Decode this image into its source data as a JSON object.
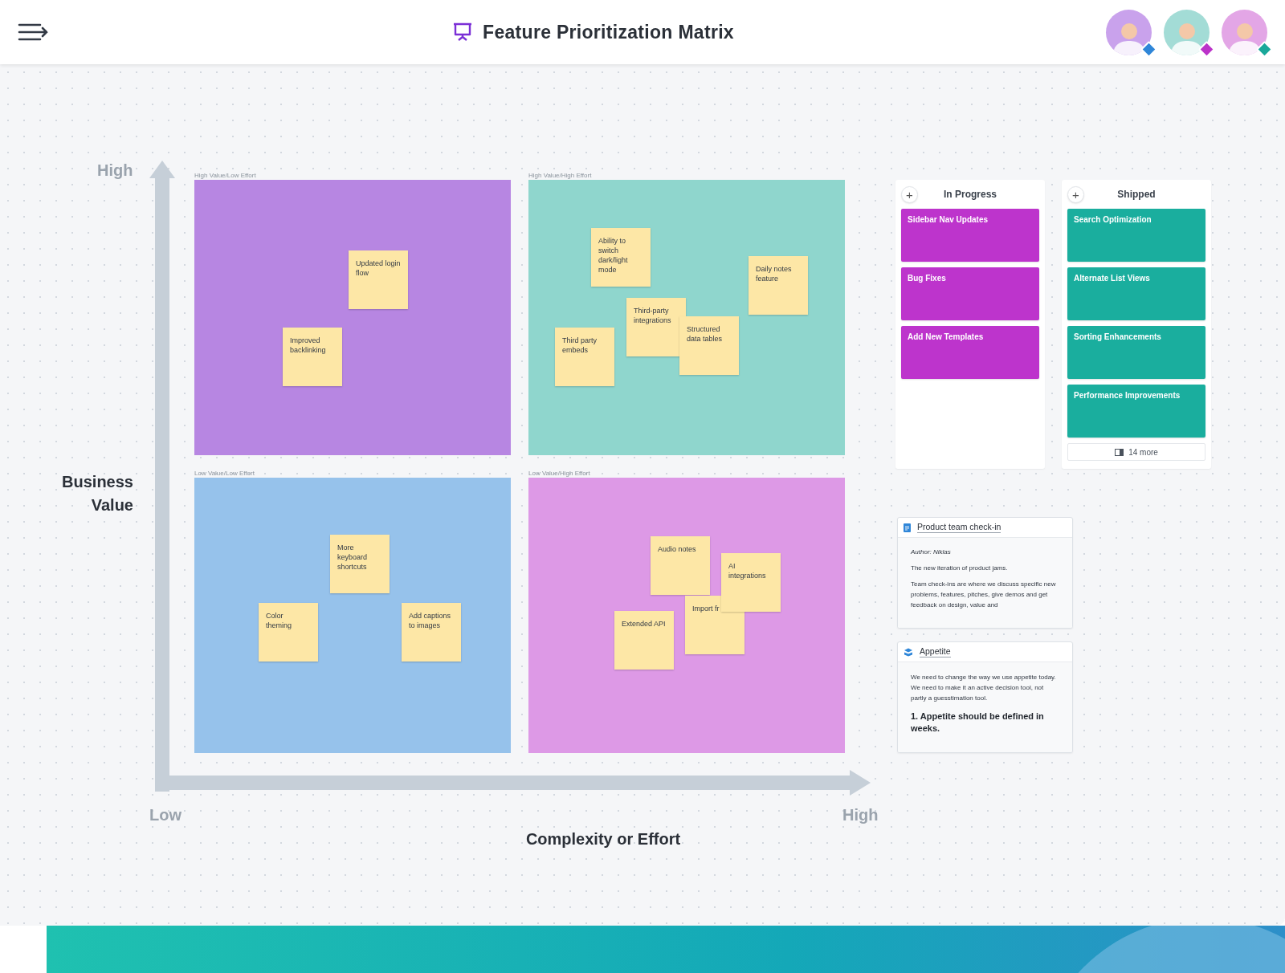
{
  "header": {
    "title": "Feature Prioritization Matrix",
    "avatars": [
      {
        "color": "#2f86d8"
      },
      {
        "color": "#bb33c9"
      },
      {
        "color": "#1aa89a"
      }
    ]
  },
  "matrix": {
    "y_high": "High",
    "y_title": "Business Value",
    "x_low": "Low",
    "x_high": "High",
    "x_title": "Complexity or Effort",
    "quadrants": [
      {
        "label": "High Value/Low Effort",
        "color": "#b786e2",
        "notes": [
          "Updated login flow",
          "Improved backlinking"
        ]
      },
      {
        "label": "High Value/High Effort",
        "color": "#8fd6cd",
        "notes": [
          "Ability to switch dark/light mode",
          "Daily notes feature",
          "Third-party integrations",
          "Structured data tables",
          "Third party embeds"
        ]
      },
      {
        "label": "Low Value/Low Effort",
        "color": "#96c2eb",
        "notes": [
          "More keyboard shortcuts",
          "Color theming",
          "Add captions to images"
        ]
      },
      {
        "label": "Low Value/High Effort",
        "color": "#dd99e6",
        "notes": [
          "Audio notes",
          "Import fr",
          "AI integrations",
          "Extended API"
        ]
      }
    ]
  },
  "boards": [
    {
      "title": "In Progress",
      "add": "+",
      "color": "#bd34cc",
      "cards": [
        "Sidebar Nav Updates",
        "Bug Fixes",
        "Add New Templates"
      ]
    },
    {
      "title": "Shipped",
      "add": "+",
      "color": "#1aae9e",
      "cards": [
        "Search Optimization",
        "Alternate List Views",
        "Sorting Enhancements",
        "Performance Improvements"
      ],
      "more": "14 more"
    }
  ],
  "docs": [
    {
      "kind": "document",
      "title": "Product team check-in",
      "blocks": [
        {
          "kind": "author",
          "text": "Author: Niklas"
        },
        {
          "kind": "p",
          "text": "The new iteration of product jams."
        },
        {
          "kind": "p",
          "text": "Team check-ins are where we discuss specific new problems, features, pitches, give demos and get feedback on design, value and"
        }
      ]
    },
    {
      "kind": "appetite",
      "title": "Appetite",
      "blocks": [
        {
          "kind": "p",
          "text": "We need to change the way we use appetite today. We need to make it an active decision tool, not partly a guesstimation tool."
        },
        {
          "kind": "heading",
          "text": "1. Appetite should be defined in weeks."
        }
      ]
    }
  ]
}
